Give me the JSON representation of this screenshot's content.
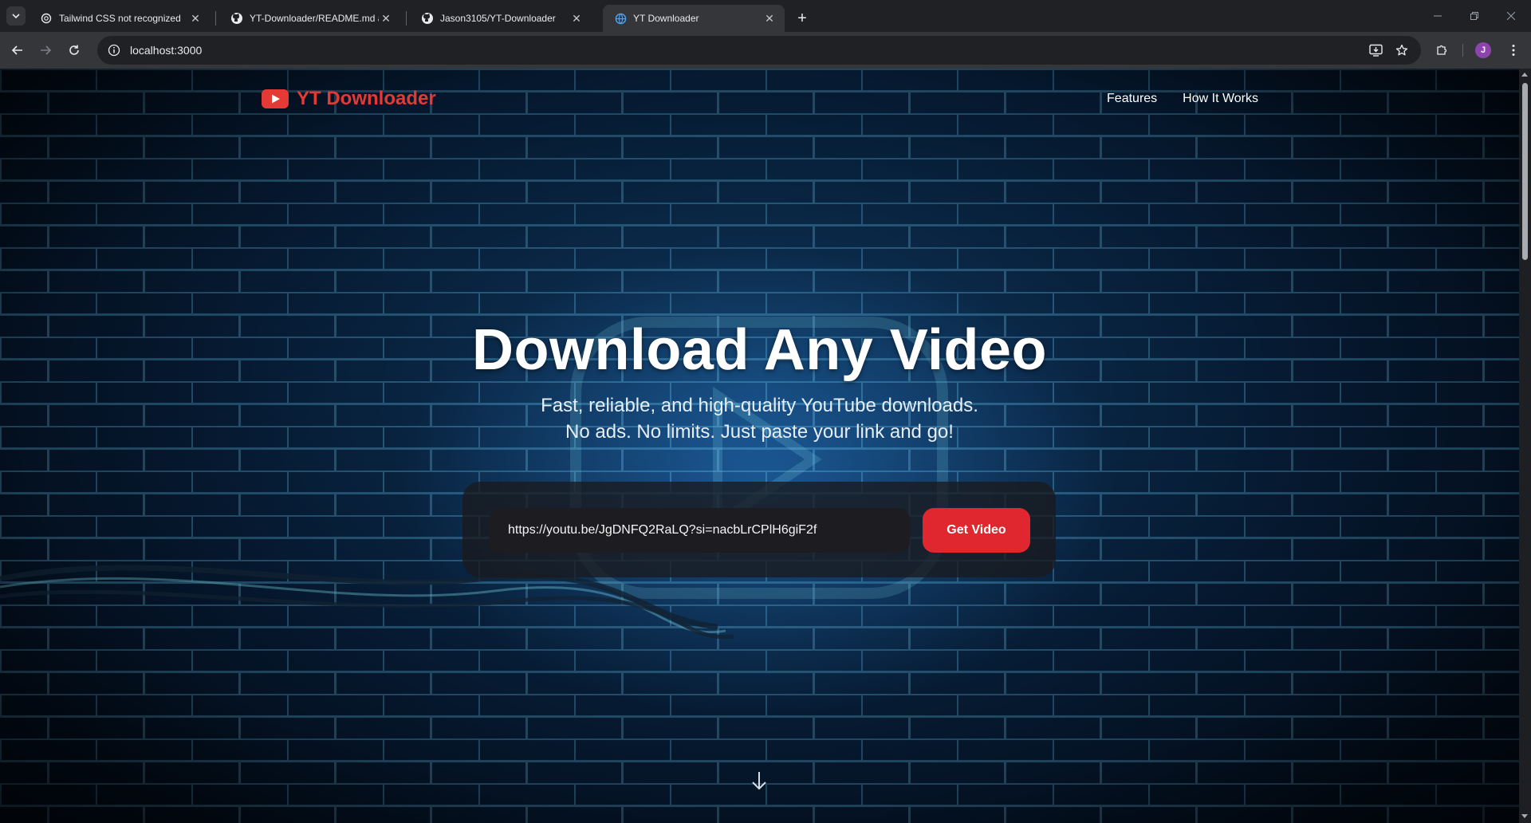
{
  "browser": {
    "tabs": [
      {
        "title": "Tailwind CSS not recognized",
        "icon": "openai-icon",
        "active": false
      },
      {
        "title": "YT-Downloader/README.md at",
        "icon": "github-icon",
        "active": false
      },
      {
        "title": "Jason3105/YT-Downloader",
        "icon": "github-icon",
        "active": false
      },
      {
        "title": "YT Downloader",
        "icon": "globe-icon",
        "active": true
      }
    ],
    "url": "localhost:3000",
    "profile_initial": "J"
  },
  "site": {
    "brand": "YT Downloader",
    "nav": [
      "Features",
      "How It Works"
    ],
    "hero": {
      "title": "Download Any Video",
      "subtitle_line1": "Fast, reliable, and high-quality YouTube downloads.",
      "subtitle_line2": "No ads. No limits. Just paste your link and go!"
    },
    "form": {
      "input_value": "https://youtu.be/JgDNFQ2RaLQ?si=nacbLrCPlH6giF2f",
      "button_label": "Get Video"
    }
  },
  "colors": {
    "brand_red": "#e53935",
    "button_red": "#e0272f",
    "tab_active": "#35363a",
    "background_blue": "#0f3a63"
  }
}
